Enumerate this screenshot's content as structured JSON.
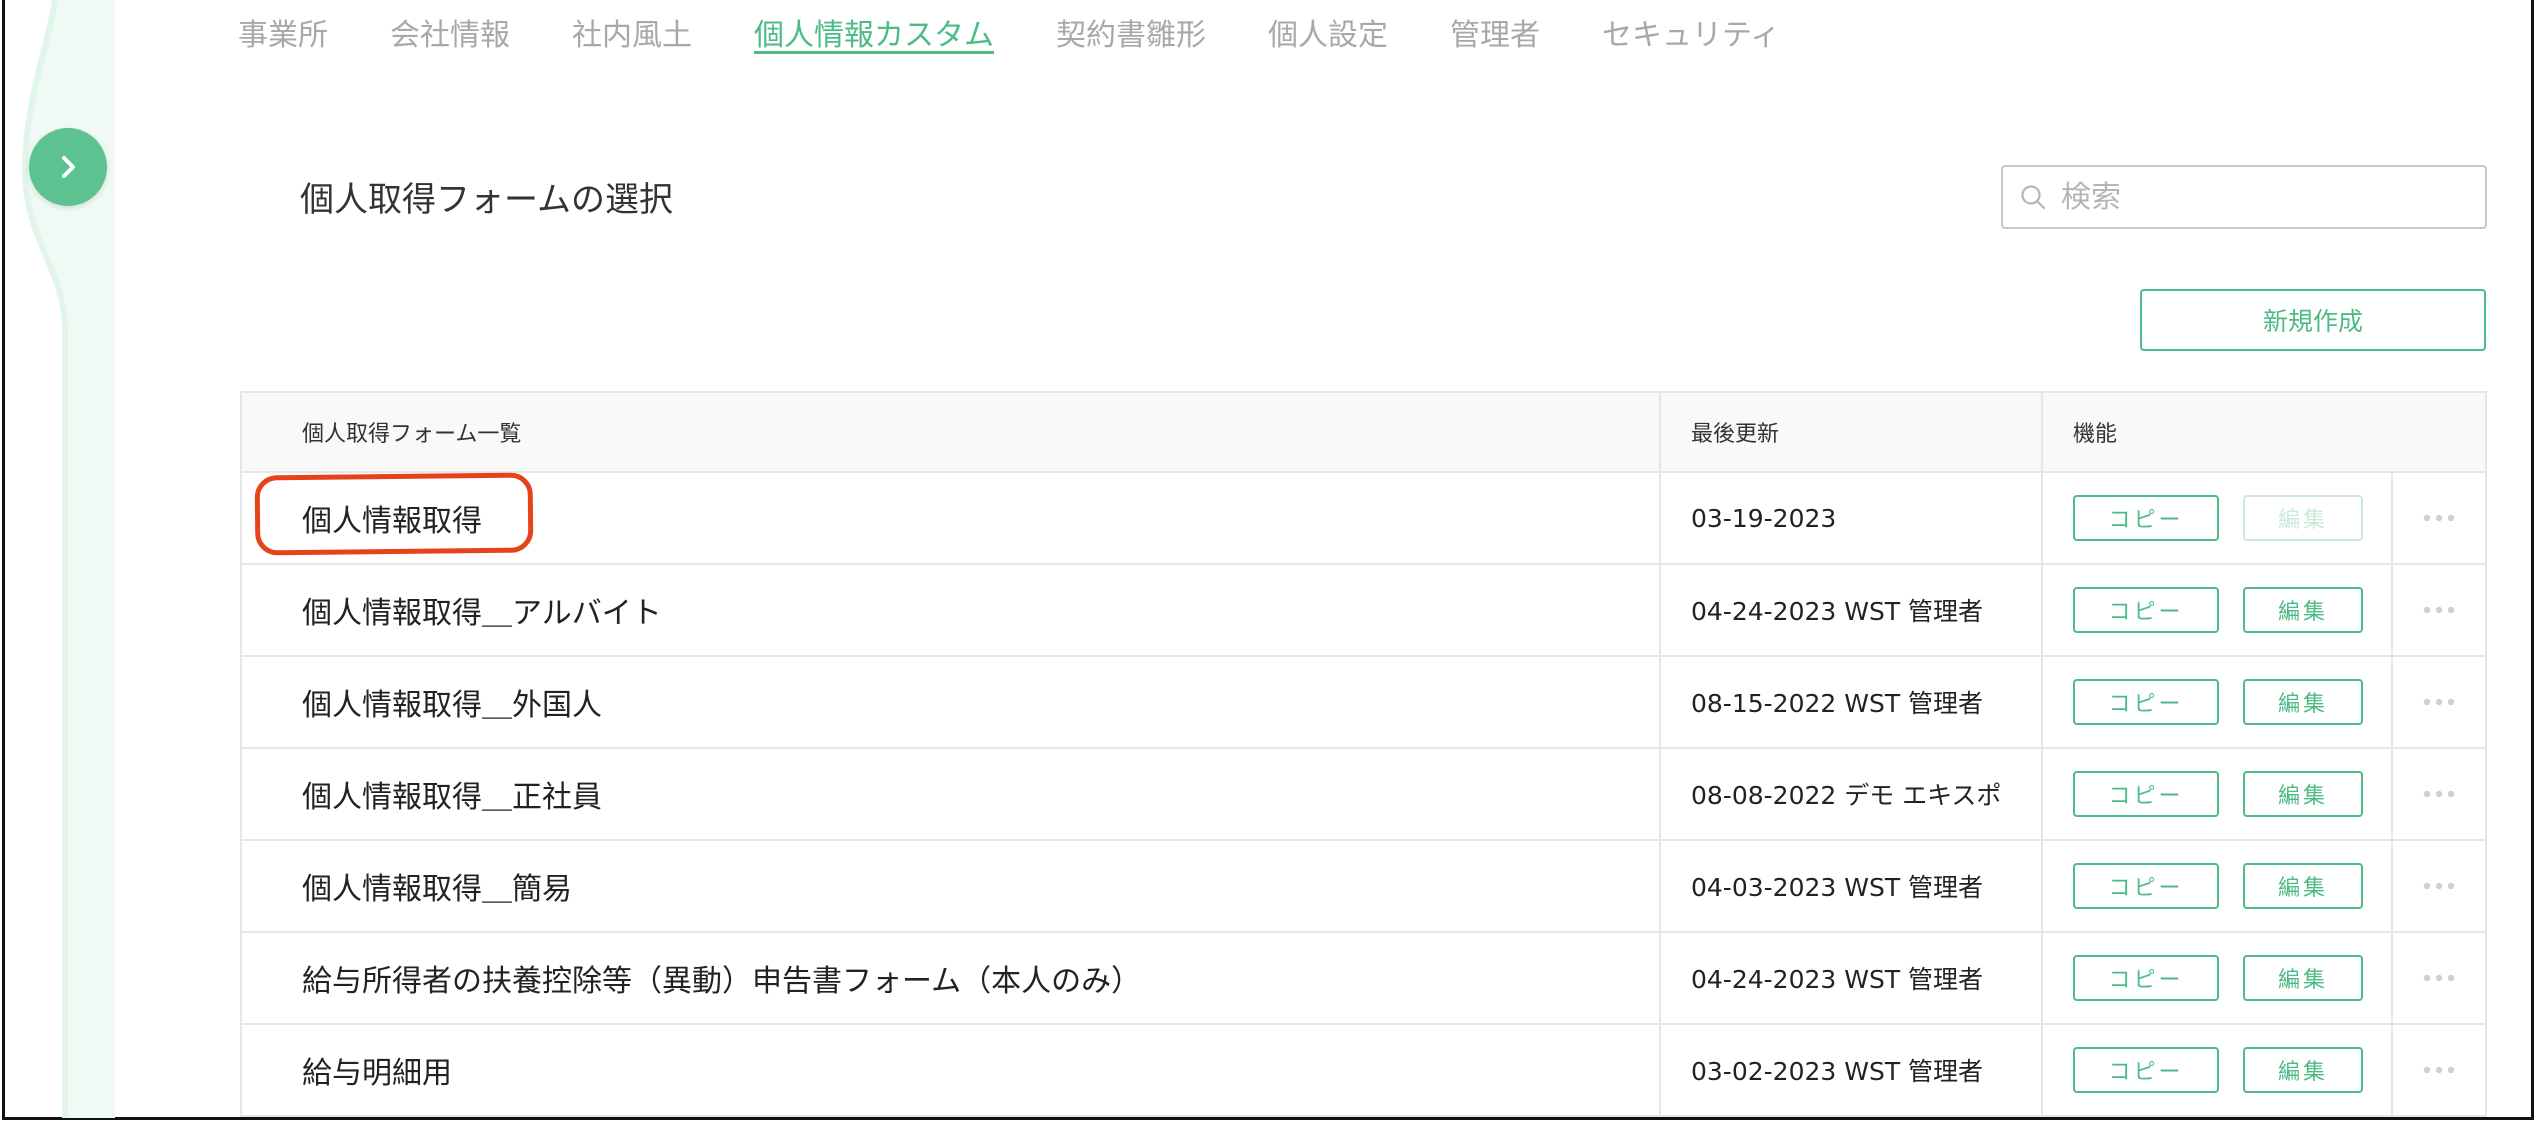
{
  "tabs": [
    {
      "label": "事業所",
      "active": false
    },
    {
      "label": "会社情報",
      "active": false
    },
    {
      "label": "社内風土",
      "active": false
    },
    {
      "label": "個人情報カスタム",
      "active": true
    },
    {
      "label": "契約書雛形",
      "active": false
    },
    {
      "label": "個人設定",
      "active": false
    },
    {
      "label": "管理者",
      "active": false
    },
    {
      "label": "セキュリティ",
      "active": false
    }
  ],
  "page_title": "個人取得フォームの選択",
  "search": {
    "placeholder": "検索",
    "value": ""
  },
  "new_button": "新規作成",
  "table": {
    "headers": {
      "name": "個人取得フォーム一覧",
      "updated": "最後更新",
      "functions": "機能"
    },
    "rows": [
      {
        "name": "個人情報取得",
        "updated": "03-19-2023",
        "copy": "コピー",
        "edit": "編集",
        "edit_enabled": false,
        "highlighted": true
      },
      {
        "name": "個人情報取得＿アルバイト",
        "updated": "04-24-2023 WST 管理者",
        "copy": "コピー",
        "edit": "編集",
        "edit_enabled": true
      },
      {
        "name": "個人情報取得＿外国人",
        "updated": "08-15-2022 WST 管理者",
        "copy": "コピー",
        "edit": "編集",
        "edit_enabled": true
      },
      {
        "name": "個人情報取得＿正社員",
        "updated": "08-08-2022 デモ エキスポ",
        "copy": "コピー",
        "edit": "編集",
        "edit_enabled": true
      },
      {
        "name": "個人情報取得＿簡易",
        "updated": "04-03-2023 WST 管理者",
        "copy": "コピー",
        "edit": "編集",
        "edit_enabled": true
      },
      {
        "name": "給与所得者の扶養控除等（異動）申告書フォーム（本人のみ）",
        "updated": "04-24-2023 WST 管理者",
        "copy": "コピー",
        "edit": "編集",
        "edit_enabled": true
      },
      {
        "name": "給与明細用",
        "updated": "03-02-2023 WST 管理者",
        "copy": "コピー",
        "edit": "編集",
        "edit_enabled": true
      }
    ]
  },
  "colors": {
    "accent": "#4dbb86",
    "annotation": "#e6431d",
    "inactive_text": "#a8a8a8"
  },
  "icons": {
    "expand": "chevron-right-icon",
    "search": "search-icon",
    "more": "more-horizontal-icon"
  }
}
